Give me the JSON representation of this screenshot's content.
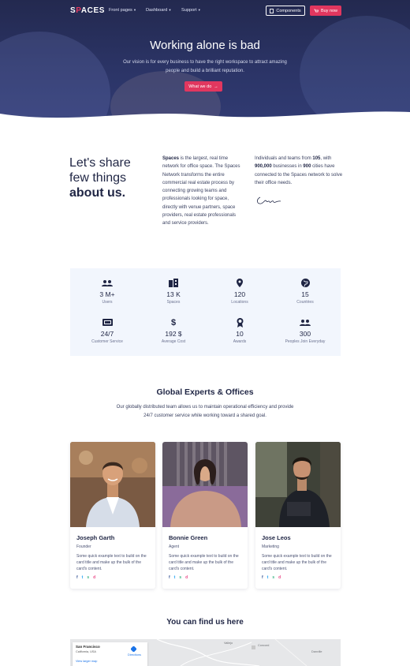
{
  "nav": {
    "logo_pre": "S",
    "logo_accent": "P",
    "logo_post": "ACES",
    "links": [
      "Front pages",
      "Dashboard",
      "Support"
    ],
    "components_label": "Components",
    "buy_label": "Buy now"
  },
  "hero": {
    "title": "Working alone is bad",
    "subtitle": "Our vision is for every business to have the right workspace to attract amazing people and build a brilliant reputation.",
    "cta_label": "What we do"
  },
  "about": {
    "heading_line1": "Let's share",
    "heading_line2": "few things",
    "heading_bold": "about us.",
    "col1_bold": "Spaces",
    "col1_text": " is the largest, real time network for office space. The Spaces Network transforms the entire commercial real estate process by connecting growing teams and professionals looking for space, directly with venue partners, space providers, real estate professionals and service providers.",
    "col2_pre": "Individuals and teams from ",
    "col2_bold1": "105",
    "col2_mid": ", with ",
    "col2_bold2": "900,000",
    "col2_mid2": " businesses in ",
    "col2_bold3": "900",
    "col2_post": " cities have connected to the Spaces network to solve their office needs."
  },
  "stats": [
    {
      "value": "3 M+",
      "label": "Users",
      "icon": "users-icon"
    },
    {
      "value": "13 K",
      "label": "Spaces",
      "icon": "building-icon"
    },
    {
      "value": "120",
      "label": "Locations",
      "icon": "map-pin-icon"
    },
    {
      "value": "15",
      "label": "Countries",
      "icon": "globe-icon"
    },
    {
      "value": "24/7",
      "label": "Customer Service",
      "icon": "ticket-icon"
    },
    {
      "value": "192 $",
      "label": "Average Cost",
      "icon": "dollar-icon"
    },
    {
      "value": "10",
      "label": "Awards",
      "icon": "award-icon"
    },
    {
      "value": "300",
      "label": "Peoples Join Everyday",
      "icon": "people-join-icon"
    }
  ],
  "team": {
    "title": "Global Experts & Offices",
    "subtitle": "Our globally distributed team allows us to maintain operational efficiency and provide 24/7 customer service while working toward a shared goal.",
    "members": [
      {
        "name": "Joseph Garth",
        "role": "Founder",
        "desc": "Some quick example text to build on the card title and make up the bulk of the card's content."
      },
      {
        "name": "Bonnie Green",
        "role": "Agent",
        "desc": "Some quick example text to build on the card title and make up the bulk of the card's content."
      },
      {
        "name": "Jose Leos",
        "role": "Marketing",
        "desc": "Some quick example text to build on the card title and make up the bulk of the card's content."
      }
    ],
    "social": [
      "f",
      "t",
      "s",
      "d"
    ]
  },
  "map": {
    "title": "You can find us here",
    "city": "San Francisco",
    "region": "California, USA",
    "larger_link": "View larger map",
    "directions": "Directions",
    "labels": [
      "Vallejo",
      "Concord",
      "Danville"
    ]
  },
  "colors": {
    "accent": "#e1375f",
    "navy": "#1f2544",
    "hero": "#2b3466",
    "stats_bg": "#f2f6fd"
  }
}
